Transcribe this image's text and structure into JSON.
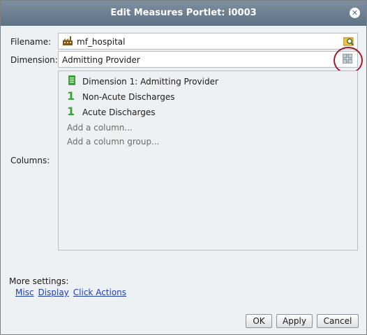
{
  "dialog": {
    "title": "Edit Measures Portlet: i0003",
    "close_icon": "close-icon"
  },
  "filename": {
    "label": "Filename:",
    "value": "mf_hospital",
    "file_icon": "factory-icon",
    "browse_icon": "search-folder-icon"
  },
  "dimension": {
    "label": "Dimension:",
    "value": "Admitting Provider",
    "picker_icon": "grid-icon"
  },
  "columns": {
    "label": "Columns:",
    "items": [
      {
        "icon": "dimension-icon",
        "label": "Dimension 1: Admitting Provider"
      },
      {
        "icon": "number-one-icon",
        "label": "Non-Acute Discharges"
      },
      {
        "icon": "number-one-icon",
        "label": "Acute Discharges"
      }
    ],
    "add_column": "Add a column...",
    "add_column_group": "Add a column group..."
  },
  "more_settings": {
    "label": "More settings:",
    "links": [
      "Misc",
      "Display",
      "Click Actions"
    ]
  },
  "buttons": {
    "ok": "OK",
    "apply": "Apply",
    "cancel": "Cancel"
  },
  "colors": {
    "titlebar": "#6b7d8e",
    "link": "#1f3fa8",
    "highlight_ring": "#9b1c2b",
    "number_icon": "#3aa13a"
  }
}
